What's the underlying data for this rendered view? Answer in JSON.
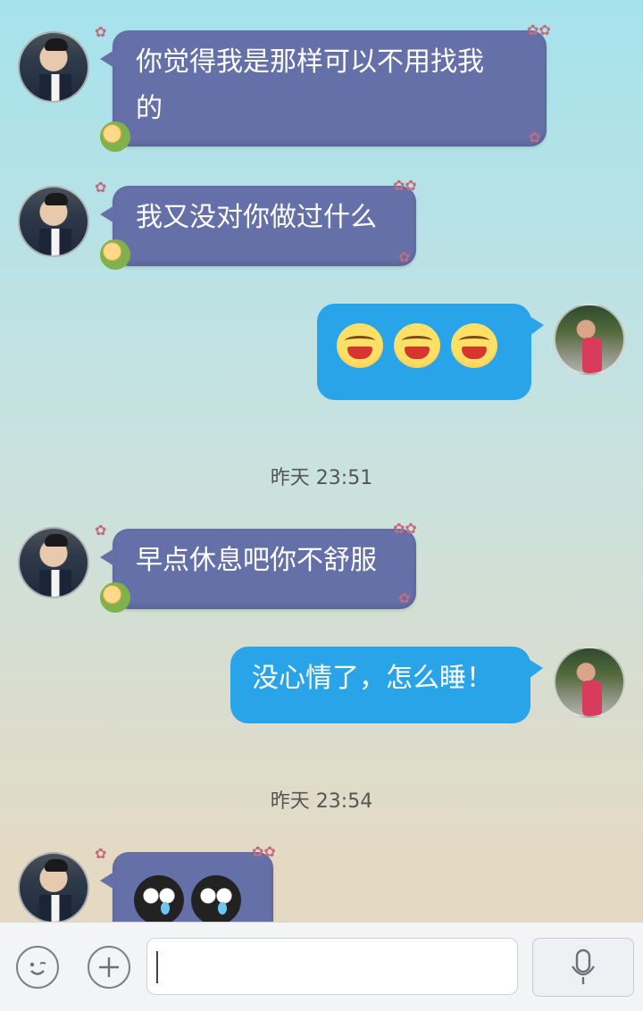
{
  "messages": [
    {
      "side": "left",
      "text": "你觉得我是那样可以不用找我的",
      "line1": "你觉得我是那样可以不用找我",
      "line2": "的"
    },
    {
      "side": "left",
      "text": "我又没对你做过什么"
    },
    {
      "side": "right",
      "emoji": [
        "laugh-emoji",
        "laugh-emoji",
        "laugh-emoji"
      ]
    },
    {
      "type": "time",
      "text": "昨天 23:51"
    },
    {
      "side": "left",
      "text": "早点休息吧你不舒服"
    },
    {
      "side": "right",
      "text": "没心情了，怎么睡！"
    },
    {
      "type": "time",
      "text": "昨天 23:54"
    },
    {
      "side": "left",
      "emoji": [
        "cry-emoji",
        "cry-emoji"
      ]
    }
  ],
  "colors": {
    "left_bubble": "#6470a7",
    "right_bubble": "#2aa4e8"
  },
  "toolbar": {
    "emoji_icon": "smile-icon",
    "plus_icon": "plus-icon",
    "mic_icon": "mic-icon",
    "input_value": ""
  }
}
